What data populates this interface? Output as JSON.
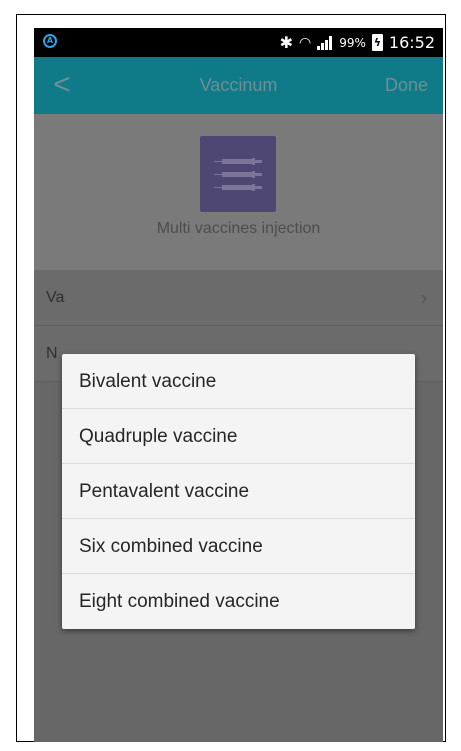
{
  "status_bar": {
    "battery_percent": "99%",
    "time": "16:52"
  },
  "header": {
    "back_glyph": "<",
    "title": "Vaccinum",
    "done_label": "Done"
  },
  "icon_area": {
    "icon": "syringes-icon",
    "caption": "Multi vaccines injection"
  },
  "rows": [
    {
      "label": "Va"
    },
    {
      "label": "N"
    }
  ],
  "dialog": {
    "options": [
      "Bivalent vaccine",
      "Quadruple vaccine",
      "Pentavalent vaccine",
      "Six combined vaccine",
      "Eight combined vaccine"
    ]
  },
  "colors": {
    "header": "#0f7a88",
    "icon_tile": "#4e4673",
    "status_bar": "#000000",
    "dialog_bg": "#f4f4f4"
  }
}
